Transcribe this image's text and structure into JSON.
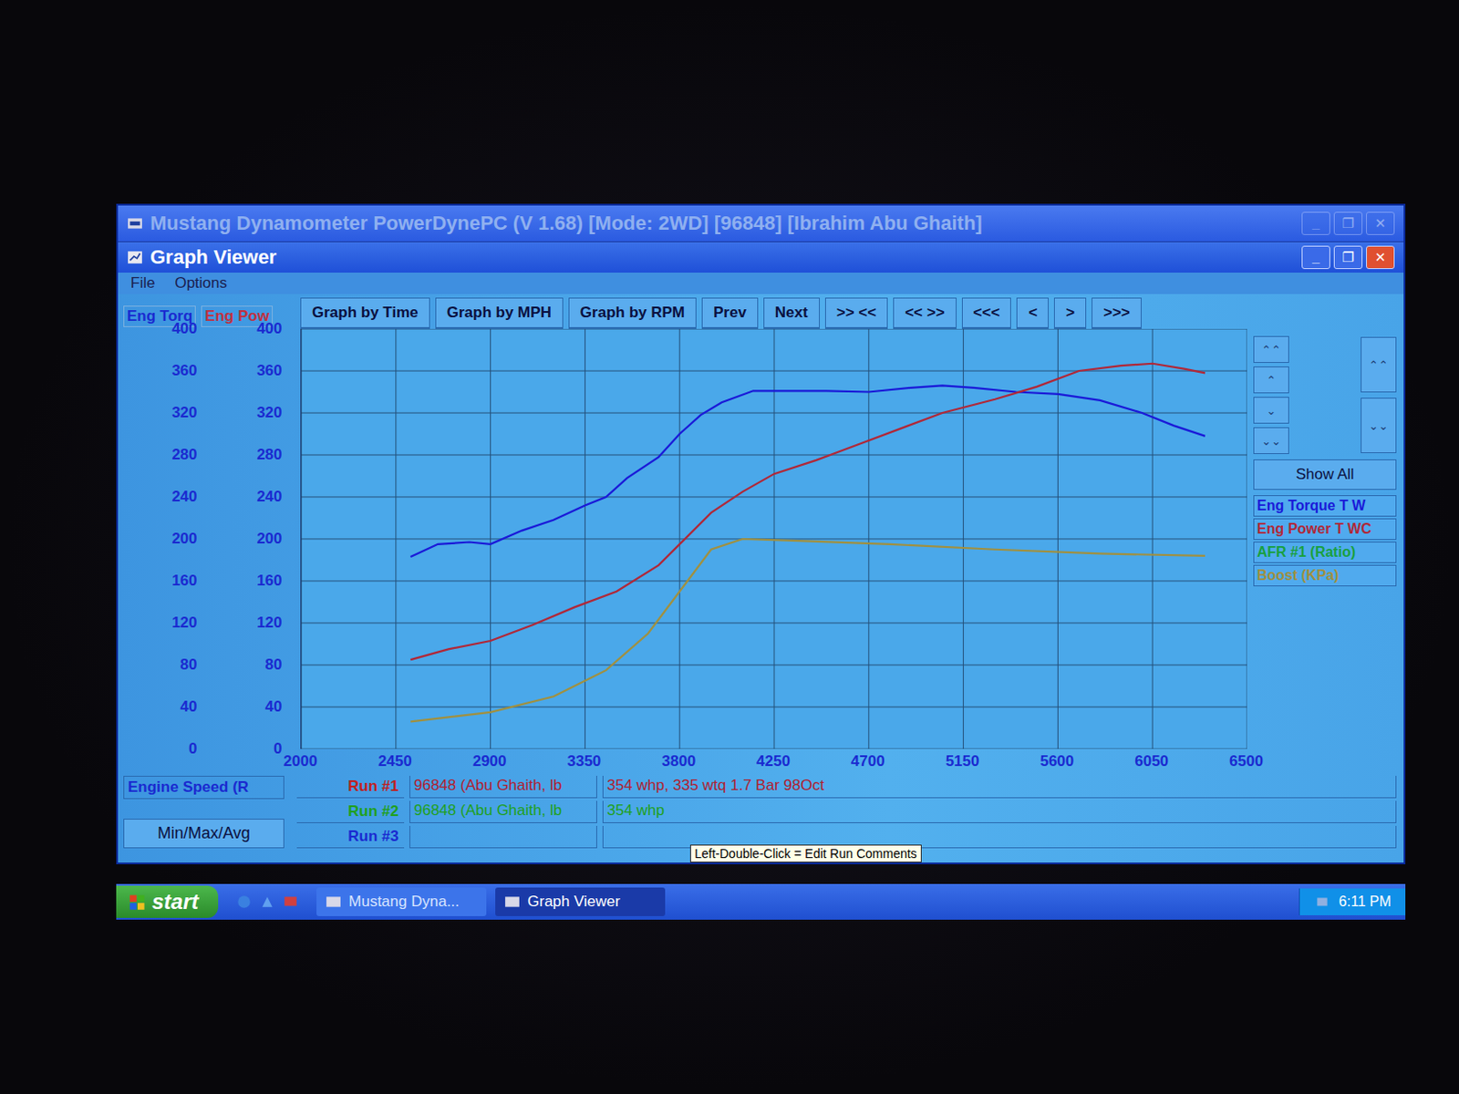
{
  "window": {
    "title": "Mustang Dynamometer PowerDynePC (V 1.68) [Mode: 2WD] [96848] [Ibrahim Abu Ghaith]"
  },
  "controls": [
    "_",
    "❐",
    "✕"
  ],
  "viewer": {
    "title": "Graph Viewer",
    "menu": [
      "File",
      "Options"
    ]
  },
  "axes": {
    "left_title": "Eng Torq",
    "right_title": "Eng Pow",
    "left_ticks": [
      "400",
      "360",
      "320",
      "280",
      "240",
      "200",
      "160",
      "120",
      "80",
      "40",
      "0"
    ],
    "right_ticks": [
      "400",
      "360",
      "320",
      "280",
      "240",
      "200",
      "160",
      "120",
      "80",
      "40",
      "0"
    ],
    "x_ticks": [
      "2000",
      "2450",
      "2900",
      "3350",
      "3800",
      "4250",
      "4700",
      "5150",
      "5600",
      "6050",
      "6500"
    ]
  },
  "toolbar": [
    "Graph by Time",
    "Graph by MPH",
    "Graph by RPM",
    "Prev",
    "Next",
    ">> <<",
    "<< >>",
    "<<<",
    "<",
    ">",
    ">>>"
  ],
  "scroll_left": [
    "⌃⌃",
    "⌃",
    "⌄",
    "⌄⌄"
  ],
  "scroll_right": [
    "⌃⌃",
    "⌄⌄"
  ],
  "show_all": "Show All",
  "series": [
    {
      "label": "Eng Torque T W",
      "color": "#1a1ad8",
      "rpm": [
        2520,
        2650,
        2800,
        2900,
        3050,
        3200,
        3350,
        3450,
        3550,
        3700,
        3800,
        3900,
        4000,
        4150,
        4300,
        4500,
        4700,
        4900,
        5050,
        5200,
        5400,
        5600,
        5800,
        6000,
        6150,
        6300
      ],
      "values": [
        183,
        195,
        197,
        195,
        208,
        218,
        232,
        240,
        258,
        278,
        300,
        318,
        330,
        341,
        341,
        341,
        340,
        344,
        346,
        344,
        340,
        338,
        332,
        320,
        308,
        298
      ]
    },
    {
      "label": "Eng Power T WC",
      "color": "#b02838",
      "rpm": [
        2520,
        2700,
        2900,
        3100,
        3300,
        3500,
        3700,
        3800,
        3950,
        4100,
        4250,
        4450,
        4650,
        4850,
        5050,
        5300,
        5500,
        5700,
        5900,
        6050,
        6200,
        6300
      ],
      "values": [
        85,
        95,
        103,
        118,
        135,
        150,
        175,
        195,
        225,
        245,
        262,
        275,
        290,
        305,
        320,
        333,
        345,
        360,
        365,
        367,
        362,
        358
      ]
    },
    {
      "label": "AFR #1 (Ratio)",
      "color": "#18a040",
      "rpm": [],
      "values": []
    },
    {
      "label": "Boost (KPa)",
      "color": "#a09040",
      "rpm": [
        2520,
        2900,
        3200,
        3450,
        3650,
        3800,
        3950,
        4100,
        4400,
        4800,
        5300,
        5800,
        6300
      ],
      "values": [
        26,
        35,
        50,
        75,
        110,
        150,
        190,
        200,
        198,
        195,
        190,
        186,
        184
      ]
    }
  ],
  "x_axis_label": "Engine Speed (R",
  "min_max": "Min/Max/Avg",
  "runs": [
    {
      "label": "Run #1",
      "file": "96848 (Abu Ghaith, lb",
      "comment": "354 whp, 335 wtq 1.7 Bar 98Oct",
      "color": "#c02020"
    },
    {
      "label": "Run #2",
      "file": "96848 (Abu Ghaith, lb",
      "comment": "354 whp",
      "color": "#20a020"
    },
    {
      "label": "Run #3",
      "file": "",
      "comment": "",
      "color": "#1a2ad0"
    }
  ],
  "tooltip": "Left-Double-Click = Edit Run Comments",
  "taskbar": {
    "start": "start",
    "tasks": [
      {
        "label": "Mustang Dyna...",
        "selected": false
      },
      {
        "label": "Graph Viewer",
        "selected": true
      }
    ],
    "clock": "6:11 PM"
  }
}
